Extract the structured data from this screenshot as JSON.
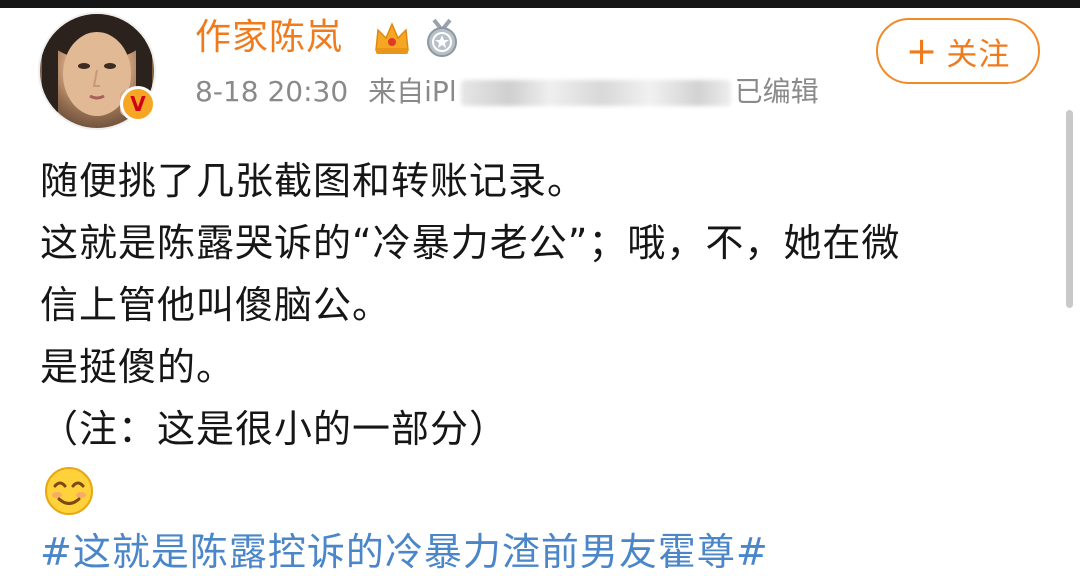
{
  "post": {
    "author": {
      "name": "作家陈岚",
      "verified_mark": "V",
      "badges": [
        "crown-icon",
        "medal-icon"
      ]
    },
    "meta": {
      "time": "8-18 20:30",
      "source_prefix": "来自",
      "source_visible_fragment": "iPl",
      "edited_suffix": "已编辑"
    },
    "follow_label": "关注",
    "follow_plus": "+",
    "lines": [
      "随便挑了几张截图和转账记录。",
      "这就是陈露哭诉的“冷暴力老公”；哦，不，她在微",
      "信上管他叫傻脑公。",
      "是挺傻的。",
      "（注：这是很小的一部分）"
    ],
    "emoji": "smiling-face-emoji",
    "hashtag": "#这就是陈露控诉的冷暴力渣前男友霍尊#"
  },
  "colors": {
    "accent": "#f07b1d",
    "link": "#4a86c8",
    "meta_text": "#8a8a8a",
    "body_text": "#161616"
  }
}
